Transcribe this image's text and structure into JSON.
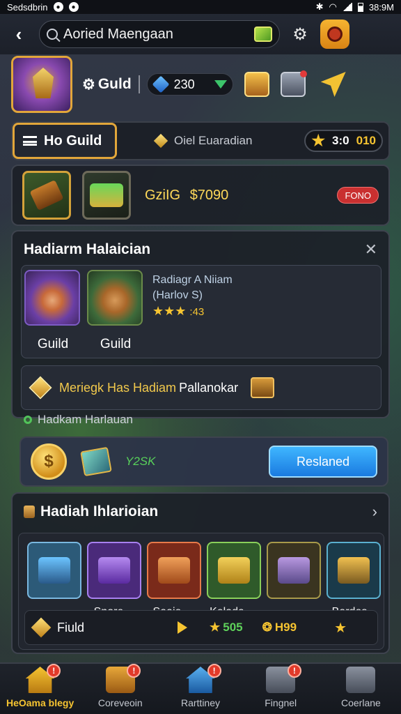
{
  "status_bar": {
    "app": "Sedsdbrin",
    "time": "38:9M"
  },
  "header": {
    "search_value": "Aoried Maengaan"
  },
  "profile": {
    "guild_label": "Guld",
    "gems": "230"
  },
  "guild_tabs": {
    "active": "Ho Guild",
    "second": "Oiel Euaradian",
    "score_a": "3:0",
    "score_b": "010"
  },
  "gold_panel": {
    "label": "GziIG",
    "amount": "$7090",
    "badge": "FONO"
  },
  "heroes_panel": {
    "title": "Hadiarm Halaician",
    "heroes": [
      {
        "name": "Guild"
      },
      {
        "name": "Guild"
      }
    ],
    "info_line1": "Radiagr A Niiam",
    "info_line2": "(Harlov S)",
    "info_rating": ":43",
    "merge_text_gold": "Meriegk Has Hadiam",
    "merge_text_white": "Pallanokar"
  },
  "subhead": "Hadkam Harlauan",
  "reward": {
    "value": "Y2SK",
    "button": "Reslaned"
  },
  "chest_panel": {
    "title": "Hadiah Ihlarioian",
    "chest_labels": [
      "Snore",
      "Saaje",
      "Kelada",
      "Bardes"
    ],
    "flow_label": "Fiuld",
    "value1": "505",
    "value2": "H99"
  },
  "bottom_nav": [
    {
      "label": "HeOama blegy",
      "badge": "!"
    },
    {
      "label": "Coreveoin",
      "badge": "!"
    },
    {
      "label": "Rarttiney",
      "badge": "!"
    },
    {
      "label": "Fingnel",
      "badge": "!"
    },
    {
      "label": "Coerlane",
      "badge": ""
    }
  ]
}
